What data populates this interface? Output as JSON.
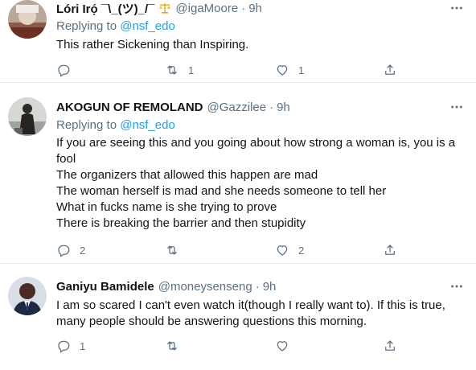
{
  "tweets": [
    {
      "name": "Lóri Irọ́ ¯\\_(ツ)_/¯",
      "handle": "@igaMoore",
      "dot": "·",
      "time": "9h",
      "replying_label": "Replying to",
      "replying_to": "@nsf_edo",
      "lines": [
        "This rather Sickening than Inspiring."
      ],
      "reply_count": "",
      "retweet_count": "1",
      "like_count": "1"
    },
    {
      "name": "AKOGUN OF REMOLAND",
      "handle": "@Gazzilee",
      "dot": "·",
      "time": "9h",
      "replying_label": "Replying to",
      "replying_to": "@nsf_edo",
      "lines": [
        "If you are seeing this and you going about how strong a woman is, you is a",
        "fool",
        "The organizers that allowed this happen are mad",
        "The woman herself is mad and she needs someone to tell her",
        "What in fucks name is she trying to prove",
        "There is breaking the barrier and then stupidity"
      ],
      "reply_count": "2",
      "retweet_count": "",
      "like_count": "2"
    },
    {
      "name": "Ganiyu Bamidele",
      "handle": "@moneysenseng",
      "dot": "·",
      "time": "9h",
      "lines": [
        "I am so scared I can't even watch it(though I really want to). If this is true,",
        "many people should be answering questions this morning."
      ],
      "reply_count": "1",
      "retweet_count": "",
      "like_count": ""
    }
  ],
  "icons": {
    "more": "more-icon",
    "reply": "reply-icon",
    "retweet": "retweet-icon",
    "like": "heart-icon",
    "share": "share-icon",
    "badge": "scales-emoji"
  },
  "colors": {
    "text": "#0f1419",
    "secondary": "#5b7083",
    "link": "#1da1f2",
    "border": "#e6ecf0"
  }
}
